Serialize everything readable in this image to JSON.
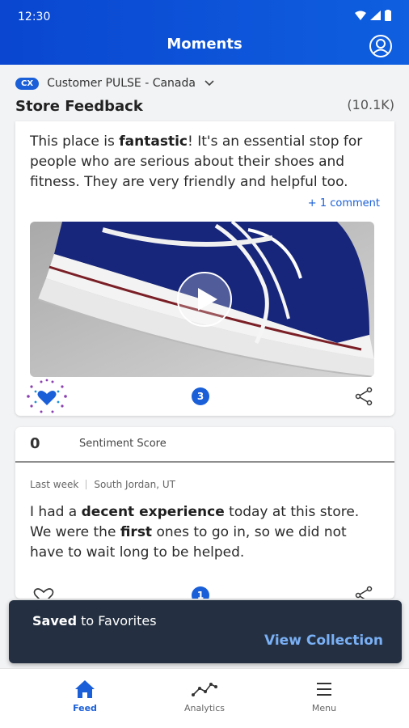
{
  "status_bar": {
    "time": "12:30"
  },
  "header": {
    "title": "Moments"
  },
  "context": {
    "badge": "CX",
    "source": "Customer PULSE - Canada"
  },
  "section": {
    "title": "Store Feedback",
    "count": "(10.1K)"
  },
  "post1": {
    "text_1": "This place is ",
    "text_bold": "fantastic",
    "text_2": "! It's an essential stop for people who are serious about their shoes and fitness. They are very friendly and helpful too.",
    "comment_link": "+ 1 comment",
    "badge_count": "3",
    "favorited": true
  },
  "post2": {
    "score_value": "0",
    "score_label": "Sentiment Score",
    "time": "Last week",
    "location": "South Jordan, UT",
    "text_1": "I had a ",
    "text_bold_1": "decent experience",
    "text_2": " today at this store. We were the ",
    "text_bold_2": "first",
    "text_3": " ones to go in, so we did not have to wait long to be helped.",
    "badge_count": "1"
  },
  "snackbar": {
    "bold": "Saved",
    "message": " to Favorites",
    "action": "View Collection"
  },
  "nav": [
    {
      "label": "Feed",
      "icon": "home-icon",
      "active": true
    },
    {
      "label": "Analytics",
      "icon": "analytics-icon",
      "active": false
    },
    {
      "label": "Menu",
      "icon": "menu-icon",
      "active": false
    }
  ],
  "colors": {
    "primary": "#0f5fe0",
    "snackbar": "#243041",
    "snack_action": "#7ab0f5"
  }
}
